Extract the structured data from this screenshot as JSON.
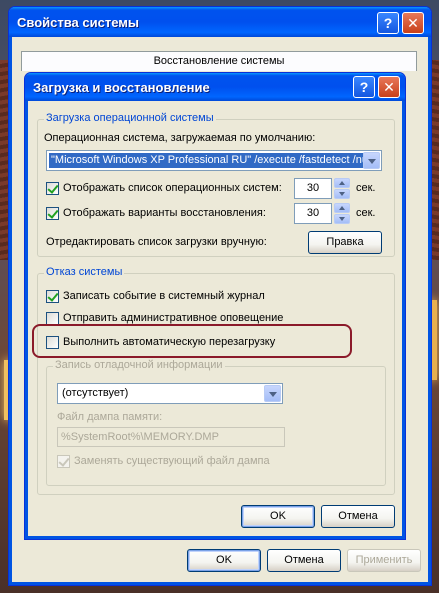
{
  "outer_dialog": {
    "title": "Свойства системы",
    "active_tab": "Восстановление системы",
    "buttons": {
      "ok": "OK",
      "cancel": "Отмена",
      "apply": "Применить"
    }
  },
  "inner_dialog": {
    "title": "Загрузка и восстановление",
    "boot": {
      "legend": "Загрузка операционной системы",
      "default_os_label": "Операционная система, загружаемая по умолчанию:",
      "default_os_value": "\"Microsoft Windows XP Professional RU\" /execute /fastdetect /nu",
      "show_os_list_label": "Отображать список операционных систем:",
      "show_os_list_checked": true,
      "show_os_list_seconds": "30",
      "show_recovery_label": "Отображать варианты восстановления:",
      "show_recovery_checked": true,
      "show_recovery_seconds": "30",
      "seconds_unit": "сек.",
      "edit_manually_label": "Отредактировать список загрузки вручную:",
      "edit_button": "Правка"
    },
    "failure": {
      "legend": "Отказ системы",
      "write_event_label": "Записать событие в системный журнал",
      "write_event_checked": true,
      "send_alert_label": "Отправить административное оповещение",
      "send_alert_checked": false,
      "auto_restart_label": "Выполнить автоматическую перезагрузку",
      "auto_restart_checked": false,
      "debug": {
        "legend": "Запись отладочной информации",
        "type_value": "(отсутствует)",
        "dump_file_label": "Файл дампа памяти:",
        "dump_file_value": "%SystemRoot%\\MEMORY.DMP",
        "overwrite_label": "Заменять существующий файл дампа",
        "overwrite_checked": true
      }
    },
    "buttons": {
      "ok": "OK",
      "cancel": "Отмена"
    }
  },
  "icons": {
    "help": "?",
    "close": "✕"
  },
  "colors": {
    "title_bar": "#0054e3",
    "highlight_ring": "#8b1a2a",
    "group_legend": "#0046d5"
  }
}
